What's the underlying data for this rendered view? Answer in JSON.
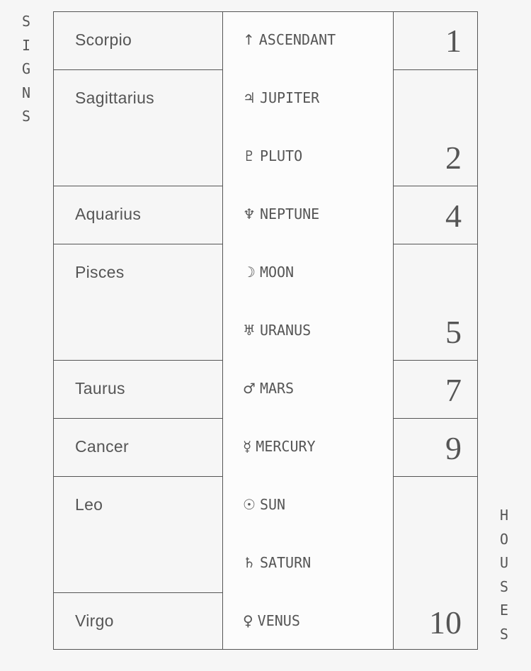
{
  "labels": {
    "signs": "SIGNS",
    "houses": "HOUSES"
  },
  "signs": [
    {
      "name": "Scorpio",
      "rows": 1
    },
    {
      "name": "Sagittarius",
      "rows": 2
    },
    {
      "name": "Aquarius",
      "rows": 1
    },
    {
      "name": "Pisces",
      "rows": 2
    },
    {
      "name": "Taurus",
      "rows": 1
    },
    {
      "name": "Cancer",
      "rows": 1
    },
    {
      "name": "Leo",
      "rows": 2
    },
    {
      "name": "Virgo",
      "rows": 1
    }
  ],
  "planets": [
    {
      "symbol": "↑",
      "name": "ASCENDANT",
      "icon": "arrow-up-icon"
    },
    {
      "symbol": "♃",
      "name": "JUPITER",
      "icon": "jupiter-icon"
    },
    {
      "symbol": "♇",
      "name": "PLUTO",
      "icon": "pluto-icon"
    },
    {
      "symbol": "♆",
      "name": "NEPTUNE",
      "icon": "neptune-icon"
    },
    {
      "symbol": "☽",
      "name": "MOON",
      "icon": "moon-icon"
    },
    {
      "symbol": "♅",
      "name": "URANUS",
      "icon": "uranus-icon"
    },
    {
      "symbol": "♂",
      "name": "MARS",
      "icon": "mars-icon"
    },
    {
      "symbol": "☿",
      "name": "MERCURY",
      "icon": "mercury-icon"
    },
    {
      "symbol": "☉",
      "name": "SUN",
      "icon": "sun-icon"
    },
    {
      "symbol": "♄",
      "name": "SATURN",
      "icon": "saturn-icon"
    },
    {
      "symbol": "♀",
      "name": "VENUS",
      "icon": "venus-icon"
    }
  ],
  "houses": [
    {
      "number": "1",
      "rows": 1
    },
    {
      "number": "2",
      "rows": 2
    },
    {
      "number": "4",
      "rows": 1
    },
    {
      "number": "5",
      "rows": 2
    },
    {
      "number": "7",
      "rows": 1
    },
    {
      "number": "9",
      "rows": 1
    },
    {
      "number": "10",
      "rows": 3
    }
  ]
}
